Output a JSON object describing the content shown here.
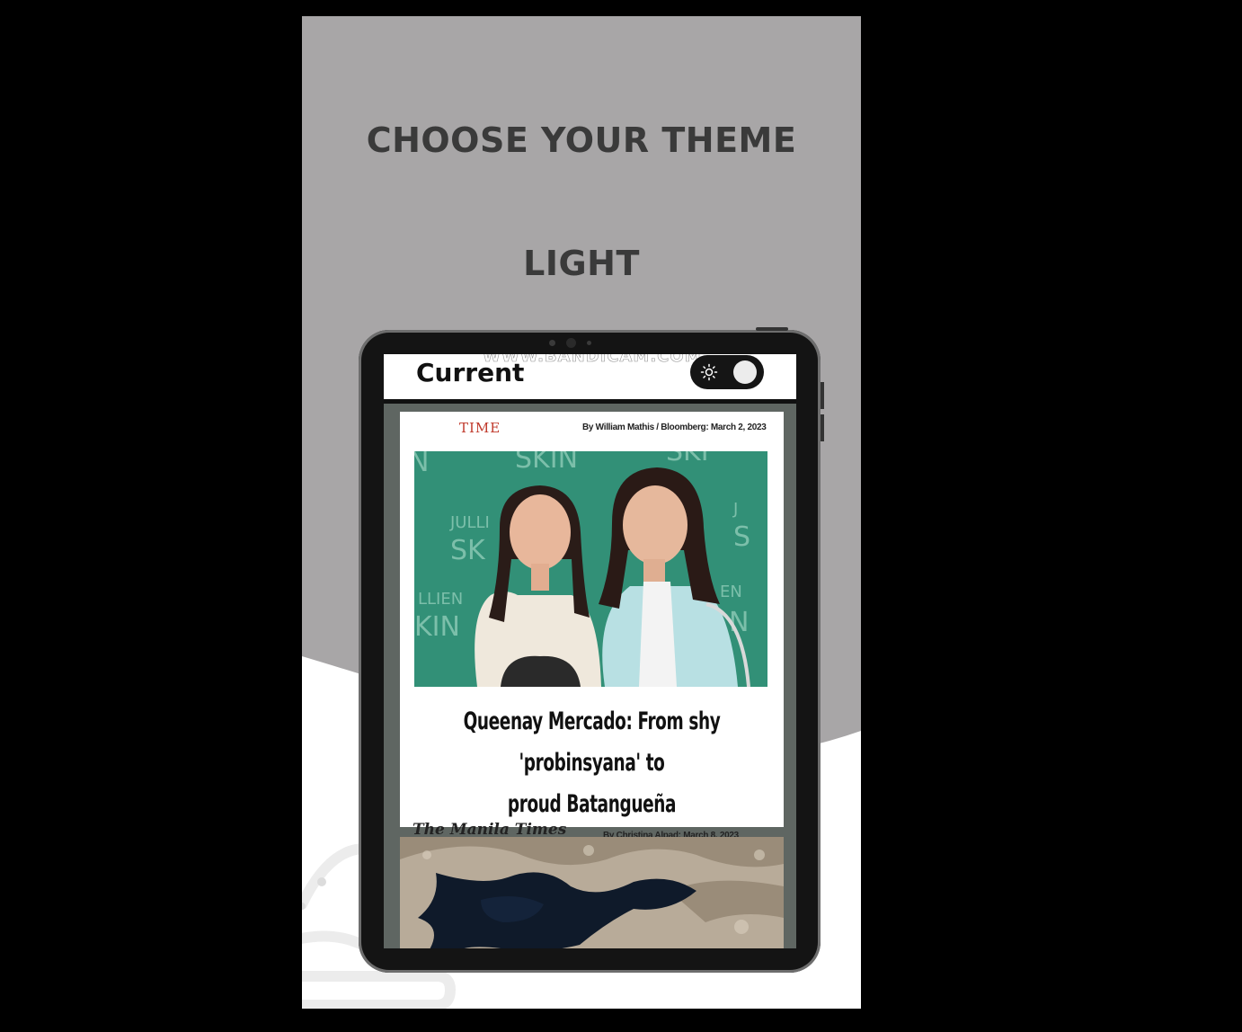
{
  "promo": {
    "title": "CHOOSE YOUR THEME",
    "subtitle": "LIGHT",
    "colors": {
      "top_background": "#a8a6a7",
      "bottom_background": "#ffffff",
      "heading_text": "#3a3a3a"
    }
  },
  "app": {
    "title": "Current",
    "watermark": "WWW.BANDICAM.COM",
    "theme_toggle": {
      "icon": "sun-icon",
      "state": "light"
    }
  },
  "feed": {
    "articles": [
      {
        "source_logo": "TIME",
        "byline": "By William Mathis / Bloomberg: March 2, 2023",
        "image": "two-women-portrait",
        "headline_line1": "Queenay Mercado: From shy 'probinsyana' to",
        "headline_line2": "proud Batangueña"
      },
      {
        "source_logo": "The Manila Times",
        "byline": "By Christina Alpad: March 8, 2023",
        "image": "aerial-landscape"
      }
    ]
  }
}
